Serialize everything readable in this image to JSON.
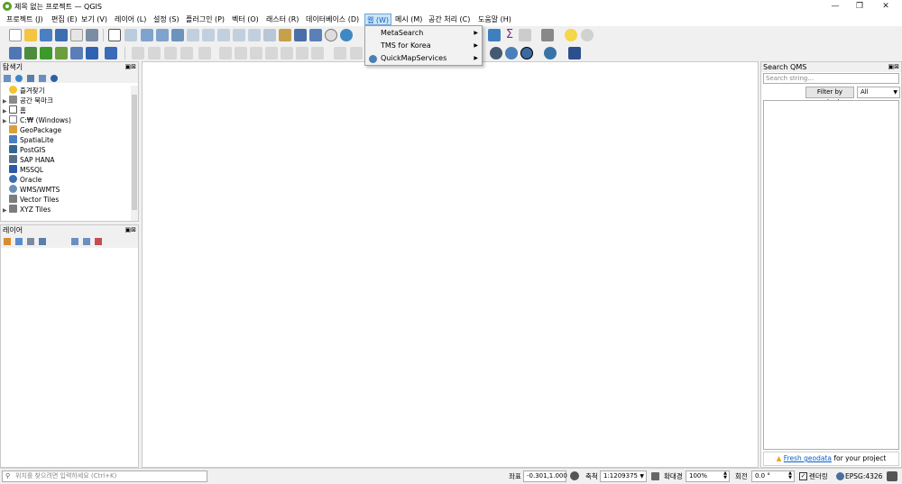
{
  "window": {
    "title": "제목 없는 프로젝트 — QGIS"
  },
  "menubar": [
    {
      "label": "프로젝트 (J)"
    },
    {
      "label": "편집 (E)"
    },
    {
      "label": "보기 (V)"
    },
    {
      "label": "레이어 (L)"
    },
    {
      "label": "설정 (S)"
    },
    {
      "label": "플러그인 (P)"
    },
    {
      "label": "벡터 (O)"
    },
    {
      "label": "래스터 (R)"
    },
    {
      "label": "데이터베이스 (D)"
    },
    {
      "label": "웹 (W)"
    },
    {
      "label": "메시 (M)"
    },
    {
      "label": "공간 처리 (C)"
    },
    {
      "label": "도움말 (H)"
    }
  ],
  "web_menu": {
    "items": [
      {
        "label": "MetaSearch",
        "icon": "none",
        "has_submenu": true
      },
      {
        "label": "TMS for Korea",
        "icon": "none",
        "has_submenu": true
      },
      {
        "label": "QuickMapServices",
        "icon": "globe-icon",
        "has_submenu": true
      }
    ]
  },
  "browser_panel": {
    "title": "탐색기",
    "items": [
      {
        "label": "즐겨찾기",
        "icon": "star-icon",
        "expandable": false
      },
      {
        "label": "공간 북마크",
        "icon": "bookmark-icon",
        "expandable": true
      },
      {
        "label": "홈",
        "icon": "home-icon",
        "expandable": true
      },
      {
        "label": "C:₩ (Windows)",
        "icon": "drive-icon",
        "expandable": true
      },
      {
        "label": "GeoPackage",
        "icon": "geopackage-icon",
        "expandable": false
      },
      {
        "label": "SpatiaLite",
        "icon": "spatialite-icon",
        "expandable": false
      },
      {
        "label": "PostGIS",
        "icon": "postgis-icon",
        "expandable": false
      },
      {
        "label": "SAP HANA",
        "icon": "sap-hana-icon",
        "expandable": false
      },
      {
        "label": "MSSQL",
        "icon": "mssql-icon",
        "expandable": false
      },
      {
        "label": "Oracle",
        "icon": "oracle-icon",
        "expandable": false
      },
      {
        "label": "WMS/WMTS",
        "icon": "wms-icon",
        "expandable": false
      },
      {
        "label": "Vector Tiles",
        "icon": "vector-tiles-icon",
        "expandable": false
      },
      {
        "label": "XYZ Tiles",
        "icon": "xyz-tiles-icon",
        "expandable": true
      }
    ]
  },
  "layers_panel": {
    "title": "레이어"
  },
  "qms_panel": {
    "title": "Search QMS",
    "search_placeholder": "Search string...",
    "filter_button": "Filter by extent",
    "filter_select": "All",
    "footer_link": "Fresh geodata",
    "footer_text": " for your project"
  },
  "statusbar": {
    "locator_placeholder": "위치를 찾으려면 입력하세요 (Ctrl+K)",
    "coord_label": "좌표",
    "coord_value": "-0.301,1.000",
    "scale_label": "축척",
    "scale_value": "1:1209375",
    "magnifier_label": "확대경",
    "magnifier_value": "100%",
    "rotation_label": "회전",
    "rotation_value": "0.0 °",
    "render_label": "렌더링",
    "render_checked": true,
    "crs": "EPSG:4326"
  },
  "colors": {
    "menu_highlight": "#cce4f7",
    "link": "#0b5ec4",
    "qgis_green": "#5a9e2a"
  }
}
